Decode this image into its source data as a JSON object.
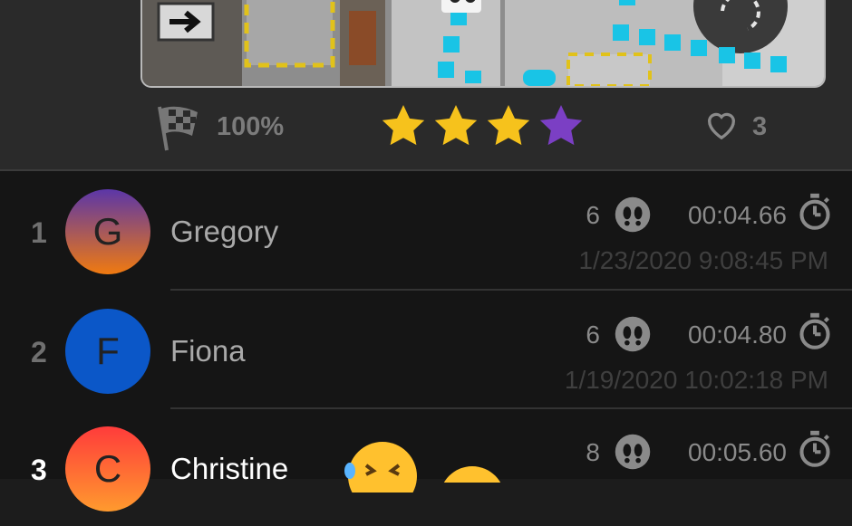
{
  "level": {
    "preview_alt": "level preview",
    "completion": "100%",
    "stars": [
      {
        "color": "#f6c21c"
      },
      {
        "color": "#f6c21c"
      },
      {
        "color": "#f6c21c"
      },
      {
        "color": "#7b3fc4"
      }
    ],
    "likes": "3"
  },
  "leaderboard": [
    {
      "rank": "1",
      "initial": "G",
      "name": "Gregory",
      "moves": "6",
      "time": "00:04.66",
      "date": "1/23/2020 9:08:45 PM",
      "avatar_from": "#5b36a8",
      "avatar_to": "#f07a10",
      "highlight": false
    },
    {
      "rank": "2",
      "initial": "F",
      "name": "Fiona",
      "moves": "6",
      "time": "00:04.80",
      "date": "1/19/2020 10:02:18 PM",
      "avatar_from": "#0b57c8",
      "avatar_to": "#0b57c8",
      "highlight": false
    },
    {
      "rank": "3",
      "initial": "C",
      "name": "Christine",
      "moves": "8",
      "time": "00:05.60",
      "date": "",
      "avatar_from": "#ff3b3b",
      "avatar_to": "#ff9a2e",
      "highlight": true
    }
  ],
  "icons": {
    "flag": "checkered-flag-icon",
    "heart": "heart-icon",
    "footprint": "footprint-icon",
    "timer": "stopwatch-icon",
    "replay": "replay-icon",
    "arrow": "arrow-right-icon"
  }
}
